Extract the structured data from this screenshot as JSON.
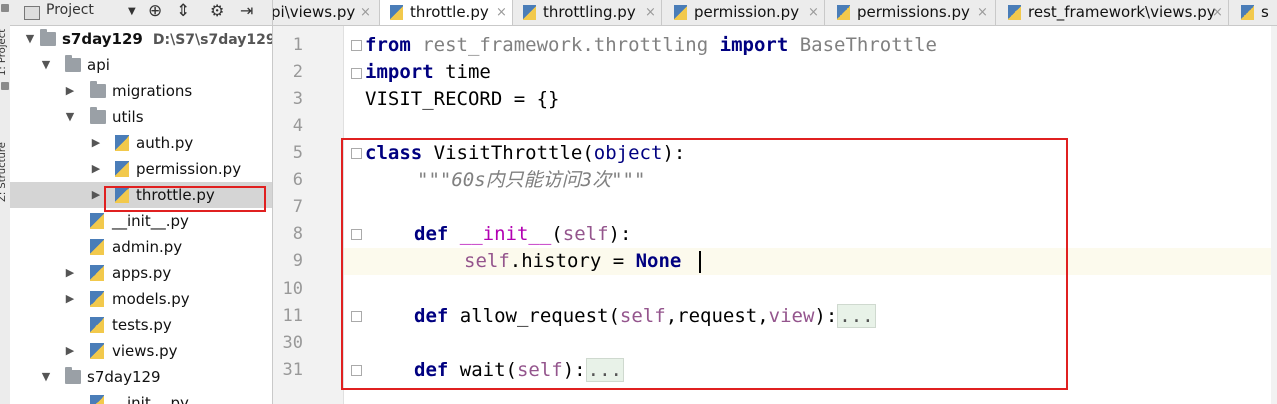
{
  "sidebar_strip": {
    "project_label": "1: Project",
    "structure_label": "Z: Structure"
  },
  "project_panel": {
    "title": "Project",
    "title_dropdown_icon": "chevron-down-icon",
    "toolbar_icons": [
      "target-icon",
      "collapse-icon",
      "gear-icon",
      "hide-icon"
    ],
    "tree": [
      {
        "label": "s7day129",
        "path": "D:\\S7\\s7day129",
        "type": "folder",
        "expanded": true,
        "bold": true
      },
      {
        "label": "api",
        "type": "folder",
        "expanded": true
      },
      {
        "label": "migrations",
        "type": "folder",
        "expanded": false
      },
      {
        "label": "utils",
        "type": "folder",
        "expanded": true
      },
      {
        "label": "auth.py",
        "type": "file",
        "expanded": false
      },
      {
        "label": "permission.py",
        "type": "file",
        "expanded": false
      },
      {
        "label": "throttle.py",
        "type": "file",
        "expanded": false,
        "selected": true
      },
      {
        "label": "__init__.py",
        "type": "file"
      },
      {
        "label": "admin.py",
        "type": "file"
      },
      {
        "label": "apps.py",
        "type": "file",
        "expanded": false
      },
      {
        "label": "models.py",
        "type": "file",
        "expanded": false
      },
      {
        "label": "tests.py",
        "type": "file"
      },
      {
        "label": "views.py",
        "type": "file",
        "expanded": false
      },
      {
        "label": "s7day129",
        "type": "folder",
        "expanded": true
      },
      {
        "label": "__init__.py",
        "type": "file"
      }
    ]
  },
  "tabs": [
    {
      "label": "pi\\views.py",
      "active": false
    },
    {
      "label": "throttle.py",
      "active": true
    },
    {
      "label": "throttling.py",
      "active": false
    },
    {
      "label": "permission.py",
      "active": false
    },
    {
      "label": "permissions.py",
      "active": false
    },
    {
      "label": "rest_framework\\views.py",
      "active": false
    },
    {
      "label": "s",
      "active": false
    }
  ],
  "tab_close_glyph": "×",
  "editor": {
    "lines": [
      {
        "num": "1"
      },
      {
        "num": "2"
      },
      {
        "num": "3"
      },
      {
        "num": "4"
      },
      {
        "num": "5"
      },
      {
        "num": "6"
      },
      {
        "num": "7"
      },
      {
        "num": "8"
      },
      {
        "num": "9"
      },
      {
        "num": "10"
      },
      {
        "num": "11"
      },
      {
        "num": "30"
      },
      {
        "num": "31"
      }
    ],
    "tokens": {
      "l1_from": "from",
      "l1_mod": " rest_framework.throttling ",
      "l1_import": "import",
      "l1_name": " BaseThrottle",
      "l2_import": "import",
      "l2_name": " time",
      "l3": "VISIT_RECORD = {}",
      "l5_class": "class",
      "l5_name": " VisitThrottle(",
      "l5_obj": "object",
      "l5_end": "):",
      "l6": "\"\"\"60s内只能访问3次\"\"\"",
      "l8_def": "def",
      "l8_init": "__init__",
      "l8_p1": "(",
      "l8_self": "self",
      "l8_p2": "):",
      "l9_self": "self",
      "l9_mid": ".history = ",
      "l9_none": "None",
      "l11_def": "def",
      "l11_name": " allow_request(",
      "l11_self": "self",
      "l11_args": ",request,",
      "l11_view": "view",
      "l11_end": "):",
      "l11_fold": "...",
      "l31_def": "def",
      "l31_name": " wait(",
      "l31_self": "self",
      "l31_end": "):",
      "l31_fold": "..."
    },
    "current_line": 9
  },
  "colors": {
    "keyword": "#000080",
    "self": "#94558d",
    "dunder": "#b200b2",
    "docstring": "#808080",
    "annotation_box": "#e02020",
    "selection": "#d5d5d5"
  }
}
